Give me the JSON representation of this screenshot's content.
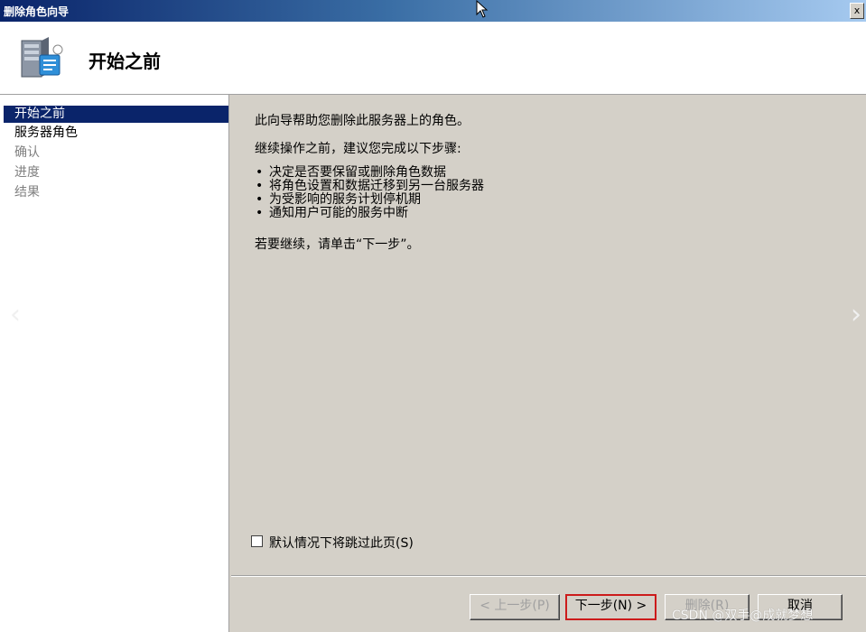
{
  "window": {
    "title": "删除角色向导",
    "close_glyph": "x"
  },
  "header": {
    "title": "开始之前",
    "icon": "server-icon"
  },
  "sidebar": {
    "items": [
      {
        "label": "开始之前",
        "state": "selected"
      },
      {
        "label": "服务器角色",
        "state": "enabled"
      },
      {
        "label": "确认",
        "state": "disabled"
      },
      {
        "label": "进度",
        "state": "disabled"
      },
      {
        "label": "结果",
        "state": "disabled"
      }
    ]
  },
  "content": {
    "intro": "此向导帮助您删除此服务器上的角色。",
    "before_continue": "继续操作之前，建议您完成以下步骤:",
    "steps": [
      "决定是否要保留或删除角色数据",
      "将角色设置和数据迁移到另一台服务器",
      "为受影响的服务计划停机期",
      "通知用户可能的服务中断"
    ],
    "continue_hint": "若要继续，请单击“下一步”。"
  },
  "skip_checkbox": {
    "label": "默认情况下将跳过此页(S)",
    "checked": false
  },
  "buttons": {
    "back": "< 上一步(P)",
    "next": "下一步(N) >",
    "delete": "删除(R)",
    "cancel": "取消"
  },
  "overlay": {
    "left_arrow": "‹",
    "right_arrow": "›",
    "watermark": "CSDN @双手@成就梦想"
  }
}
